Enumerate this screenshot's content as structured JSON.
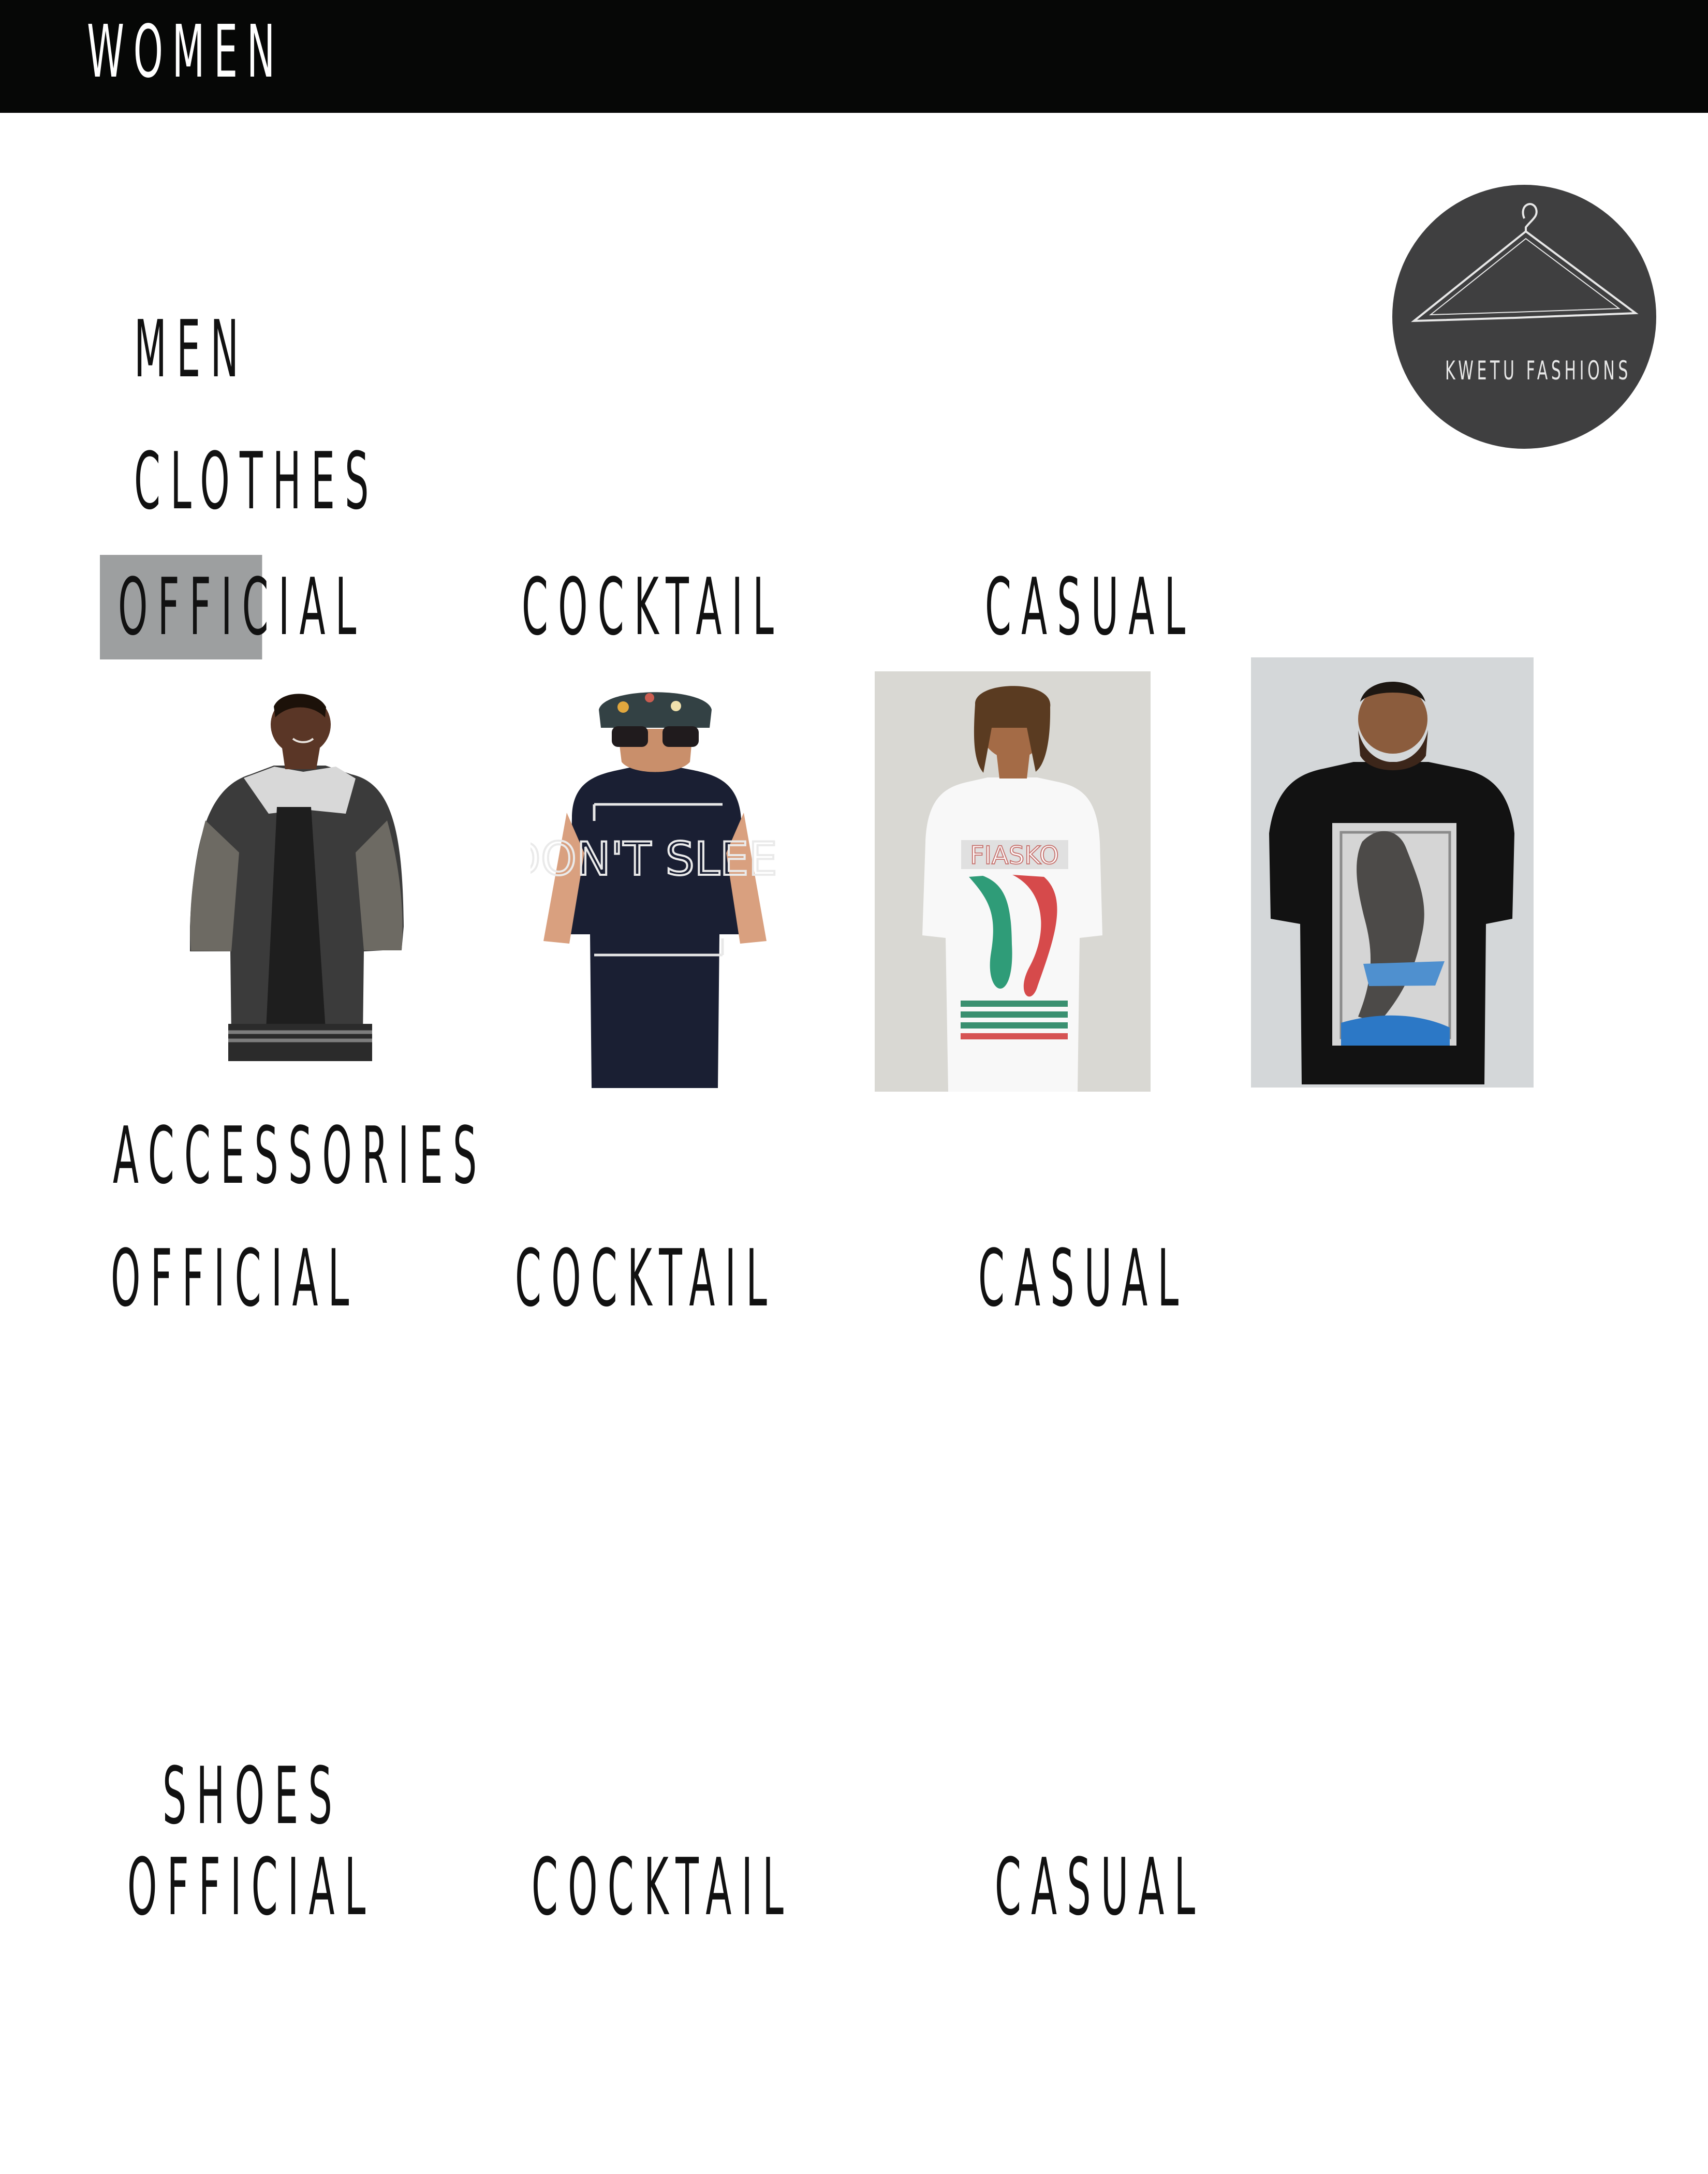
{
  "header": {
    "title": "WOMEN"
  },
  "brand": {
    "logo_text": "KWETU FASHIONS"
  },
  "nav": {
    "men_label": "MEN",
    "clothes_label": "CLOTHES",
    "accessories_label": "ACCESSORIES",
    "shoes_label": "SHOES"
  },
  "clothes_filters": {
    "official": "OFFICIAL",
    "cocktail": "COCKTAIL",
    "casual": "CASUAL",
    "selected": "OFFICIAL"
  },
  "accessories_filters": {
    "official": "OFFICIAL",
    "cocktail": "COCKTAIL",
    "casual": "CASUAL"
  },
  "shoes_filters": {
    "official": "OFFICIAL",
    "cocktail": "COCKTAIL",
    "casual": "CASUAL"
  },
  "products": [
    {
      "name": "varsity-jacket",
      "graphic_text": ""
    },
    {
      "name": "dont-sleep-tee",
      "graphic_text": "DON'T SLEEP"
    },
    {
      "name": "fiasko-tee",
      "graphic_text": "FIASKO"
    },
    {
      "name": "graphic-photo-tee",
      "graphic_text": ""
    }
  ],
  "colors": {
    "header_bg": "#060706",
    "selected_bg": "#9d9fa0",
    "logo_bg": "#3f3f40",
    "accent_green": "#2f9c78",
    "accent_red": "#d64a4b",
    "accent_blue": "#2c78c6"
  }
}
